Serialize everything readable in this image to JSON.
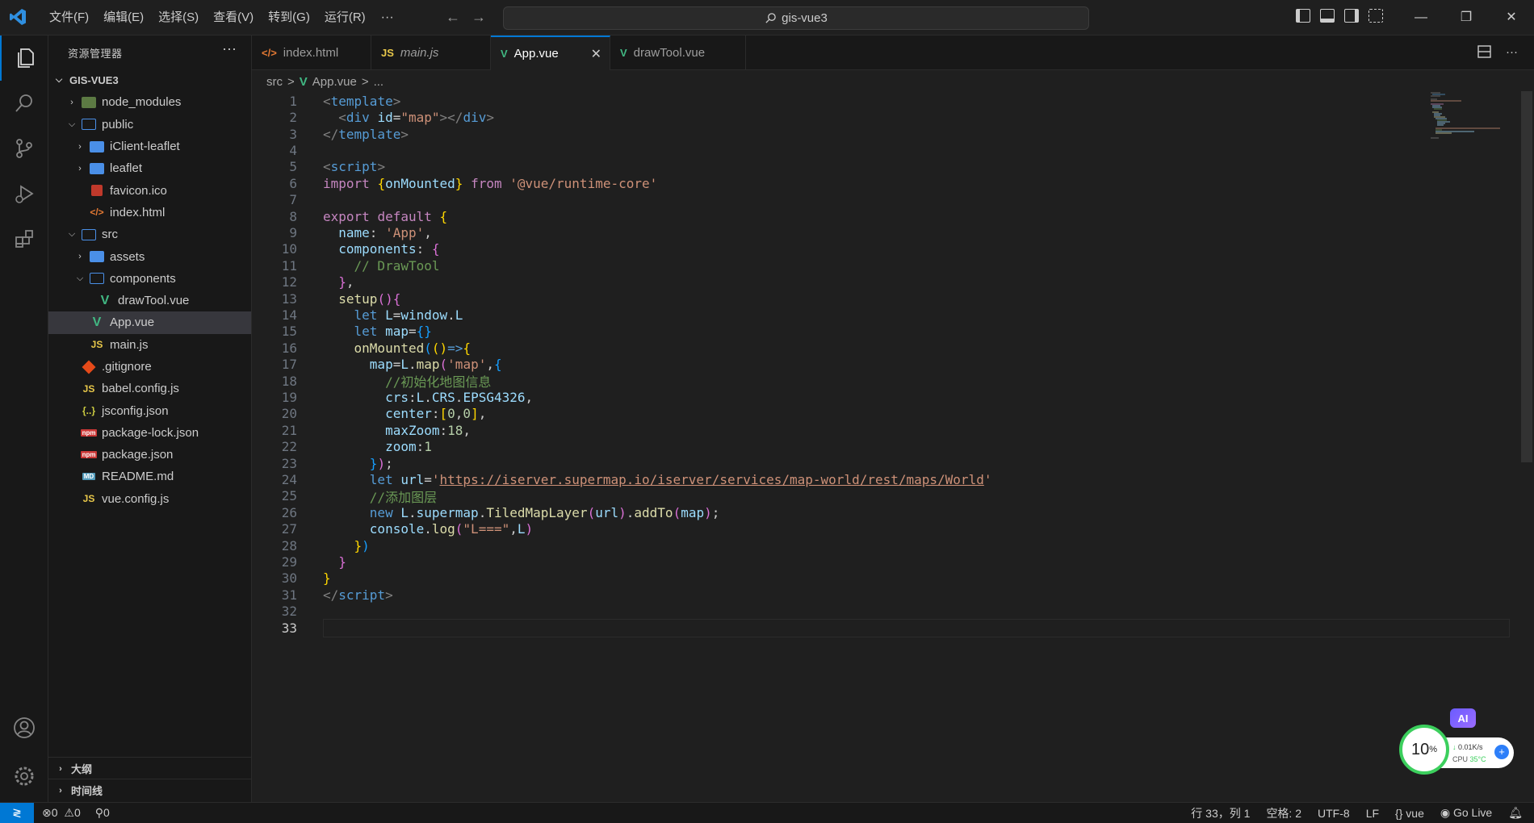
{
  "titlebar": {
    "menus": [
      "文件(F)",
      "编辑(E)",
      "选择(S)",
      "查看(V)",
      "转到(G)",
      "运行(R)"
    ],
    "more": "···",
    "search_text": "gis-vue3",
    "back_arrow": "←",
    "forward_arrow": "→",
    "win_min": "—",
    "win_restore": "❐",
    "win_close": "✕"
  },
  "sidebar": {
    "title": "资源管理器",
    "more": "···",
    "project": "GIS-VUE3",
    "tree": [
      {
        "label": "node_modules",
        "icon": "folder-node-icon"
      },
      {
        "label": "public",
        "icon": "folder-open-icon"
      },
      {
        "label": "iClient-leaflet",
        "icon": "folder-icon"
      },
      {
        "label": "leaflet",
        "icon": "folder-icon"
      },
      {
        "label": "favicon.ico",
        "icon": "favicon-icon"
      },
      {
        "label": "index.html",
        "icon": "html-icon",
        "icon_text": "</>"
      },
      {
        "label": "src",
        "icon": "folder-open-icon"
      },
      {
        "label": "assets",
        "icon": "folder-icon"
      },
      {
        "label": "components",
        "icon": "folder-open-icon"
      },
      {
        "label": "drawTool.vue",
        "icon": "vue-icon",
        "icon_text": "V"
      },
      {
        "label": "App.vue",
        "icon": "vue-icon",
        "icon_text": "V"
      },
      {
        "label": "main.js",
        "icon": "js-icon",
        "icon_text": "JS"
      },
      {
        "label": ".gitignore",
        "icon": "git-icon"
      },
      {
        "label": "babel.config.js",
        "icon": "js-icon",
        "icon_text": "JS"
      },
      {
        "label": "jsconfig.json",
        "icon": "json-icon",
        "icon_text": "{..}"
      },
      {
        "label": "package-lock.json",
        "icon": "npm-icon",
        "icon_text": "npm"
      },
      {
        "label": "package.json",
        "icon": "npm-icon",
        "icon_text": "npm"
      },
      {
        "label": "README.md",
        "icon": "markdown-icon",
        "icon_text": "MD"
      },
      {
        "label": "vue.config.js",
        "icon": "js-icon",
        "icon_text": "JS"
      }
    ],
    "outline": "大纲",
    "timeline": "时间线"
  },
  "tabs": [
    {
      "label": "index.html",
      "icon_text": "</>"
    },
    {
      "label": "main.js",
      "icon_text": "JS"
    },
    {
      "label": "App.vue",
      "icon_text": "V",
      "close": "✕"
    },
    {
      "label": "drawTool.vue",
      "icon_text": "V"
    }
  ],
  "breadcrumb": {
    "folder": "src",
    "sep": ">",
    "file": "App.vue",
    "ellipsis": "..."
  },
  "editor": {
    "line_numbers": [
      "1",
      "2",
      "3",
      "4",
      "5",
      "6",
      "7",
      "8",
      "9",
      "10",
      "11",
      "12",
      "13",
      "14",
      "15",
      "16",
      "17",
      "18",
      "19",
      "20",
      "21",
      "22",
      "23",
      "24",
      "25",
      "26",
      "27",
      "28",
      "29",
      "30",
      "31",
      "32",
      "33"
    ],
    "current_line": 33,
    "url": "https://iserver.supermap.io/iserver/services/map-world/rest/maps/World"
  },
  "widget": {
    "ai_label": "AI",
    "percent": "10",
    "percent_unit": "%",
    "net_speed": "0.01K/s",
    "cpu_label": "CPU",
    "cpu_temp": "35°C",
    "plus": "+"
  },
  "statusbar": {
    "remote": "≷",
    "errors": "0",
    "warnings": "0",
    "ports": "0",
    "position": "行 33，列 1",
    "spaces": "空格: 2",
    "encoding": "UTF-8",
    "eol": "LF",
    "language": "vue",
    "golive": "Go Live"
  },
  "colors": {
    "accent": "#0078d4",
    "vue": "#41b883",
    "folder": "#4a8fe7",
    "js": "#e8c84a",
    "cpu_ok": "#3ccf5d"
  }
}
